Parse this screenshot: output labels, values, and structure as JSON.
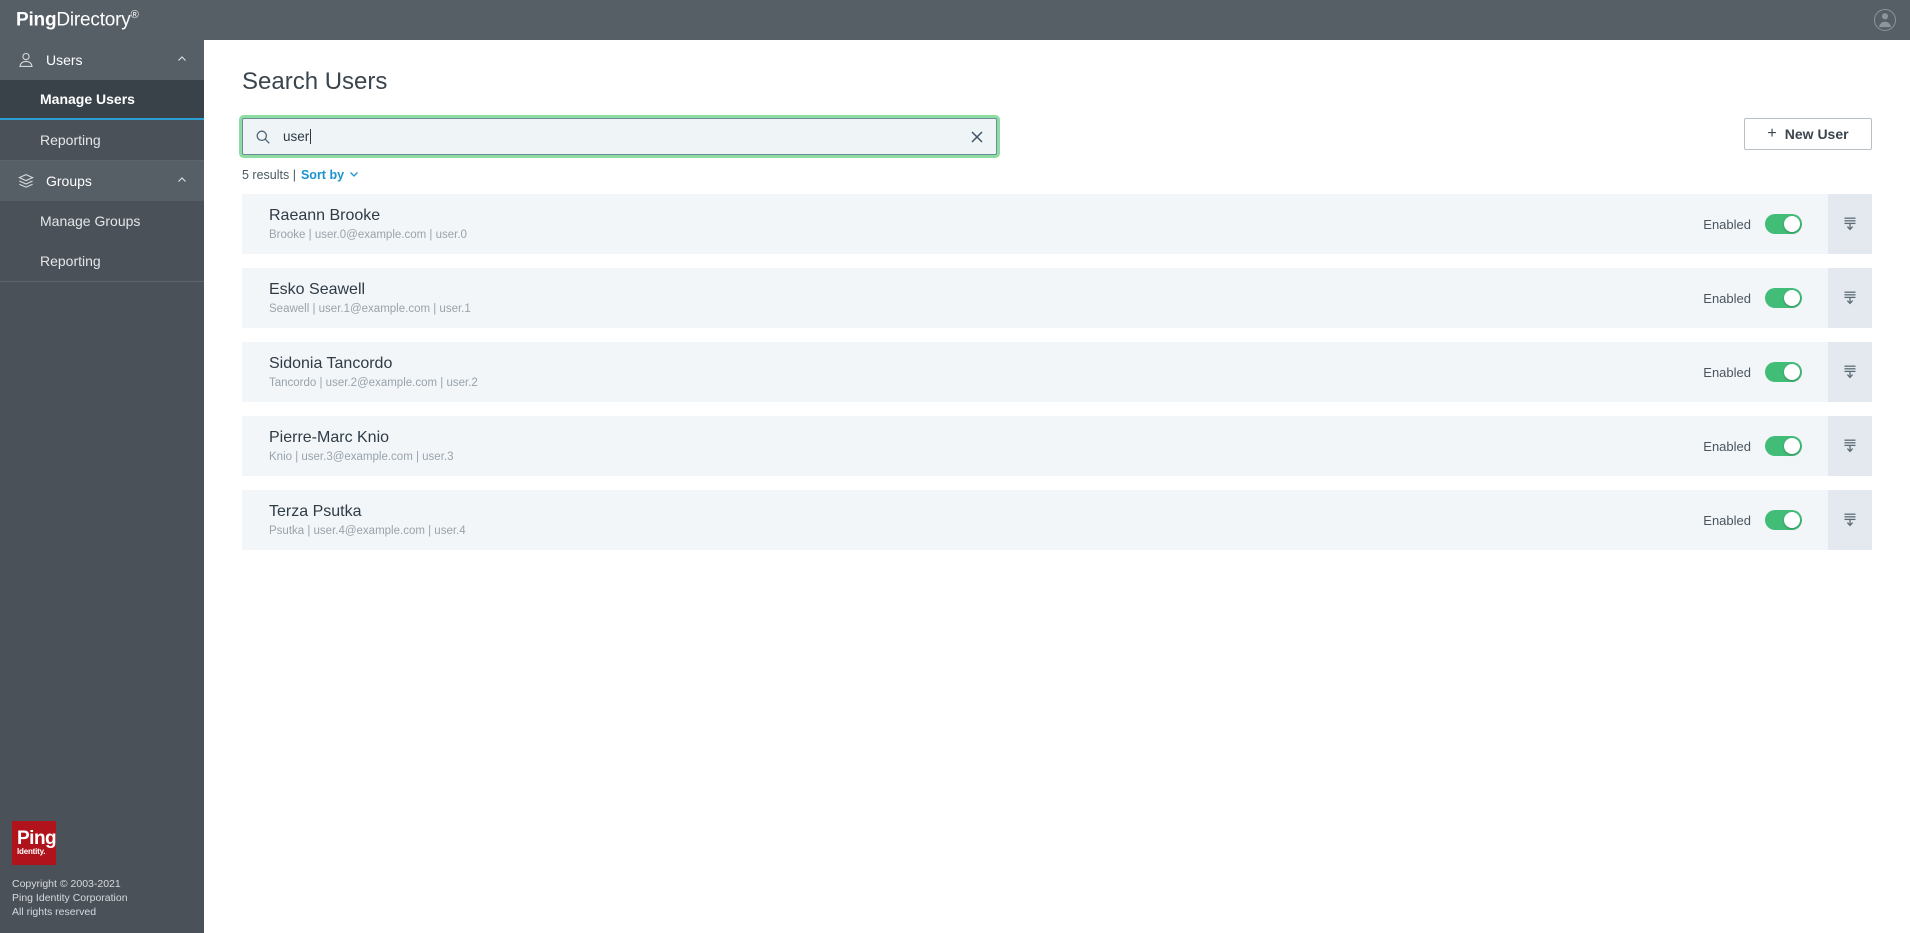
{
  "header": {
    "logo_bold": "Ping",
    "logo_light": "Directory",
    "logo_tm": "®",
    "avatar_icon": "user-avatar-icon"
  },
  "sidebar": {
    "sections": [
      {
        "label": "Users",
        "icon": "person-icon",
        "chevron": "chevron-up-icon",
        "items": [
          {
            "label": "Manage Users",
            "active": true
          },
          {
            "label": "Reporting",
            "active": false
          }
        ]
      },
      {
        "label": "Groups",
        "icon": "layers-icon",
        "chevron": "chevron-up-icon",
        "items": [
          {
            "label": "Manage Groups",
            "active": false
          },
          {
            "label": "Reporting",
            "active": false
          }
        ]
      }
    ],
    "footer": {
      "logo_line1": "Ping",
      "logo_line2": "Identity.",
      "copyright_line1": "Copyright © 2003-2021",
      "copyright_line2": "Ping Identity Corporation",
      "copyright_line3": "All rights reserved"
    }
  },
  "main": {
    "title": "Search Users",
    "search": {
      "value": "user",
      "placeholder": "",
      "icon": "search-icon",
      "clear_icon": "close-icon"
    },
    "new_user_button": {
      "label": "New User",
      "plus": "+"
    },
    "results_bar": {
      "count_text": "5 results |",
      "sort_label": "Sort by",
      "sort_chevron": "chevron-down-icon"
    },
    "rows": [
      {
        "name": "Raeann Brooke",
        "details": "Brooke | user.0@example.com | user.0",
        "status": "Enabled",
        "toggle_on": true,
        "action_icon": "collapse-details-icon"
      },
      {
        "name": "Esko Seawell",
        "details": "Seawell | user.1@example.com | user.1",
        "status": "Enabled",
        "toggle_on": true,
        "action_icon": "collapse-details-icon"
      },
      {
        "name": "Sidonia Tancordo",
        "details": "Tancordo | user.2@example.com | user.2",
        "status": "Enabled",
        "toggle_on": true,
        "action_icon": "collapse-details-icon"
      },
      {
        "name": "Pierre-Marc Knio",
        "details": "Knio | user.3@example.com | user.3",
        "status": "Enabled",
        "toggle_on": true,
        "action_icon": "collapse-details-icon"
      },
      {
        "name": "Terza Psutka",
        "details": "Psutka | user.4@example.com | user.4",
        "status": "Enabled",
        "toggle_on": true,
        "action_icon": "collapse-details-icon"
      }
    ]
  },
  "colors": {
    "header_bar": "#565e66",
    "sidebar": "#4a5158",
    "sidebar_active": "#3a4249",
    "accent_blue": "#2b9fd4",
    "link_blue": "#1b93cf",
    "focus_green": "#8ddca2",
    "toggle_green": "#42bd78",
    "brand_red": "#b0131b",
    "row_bg": "#f2f6f9"
  }
}
